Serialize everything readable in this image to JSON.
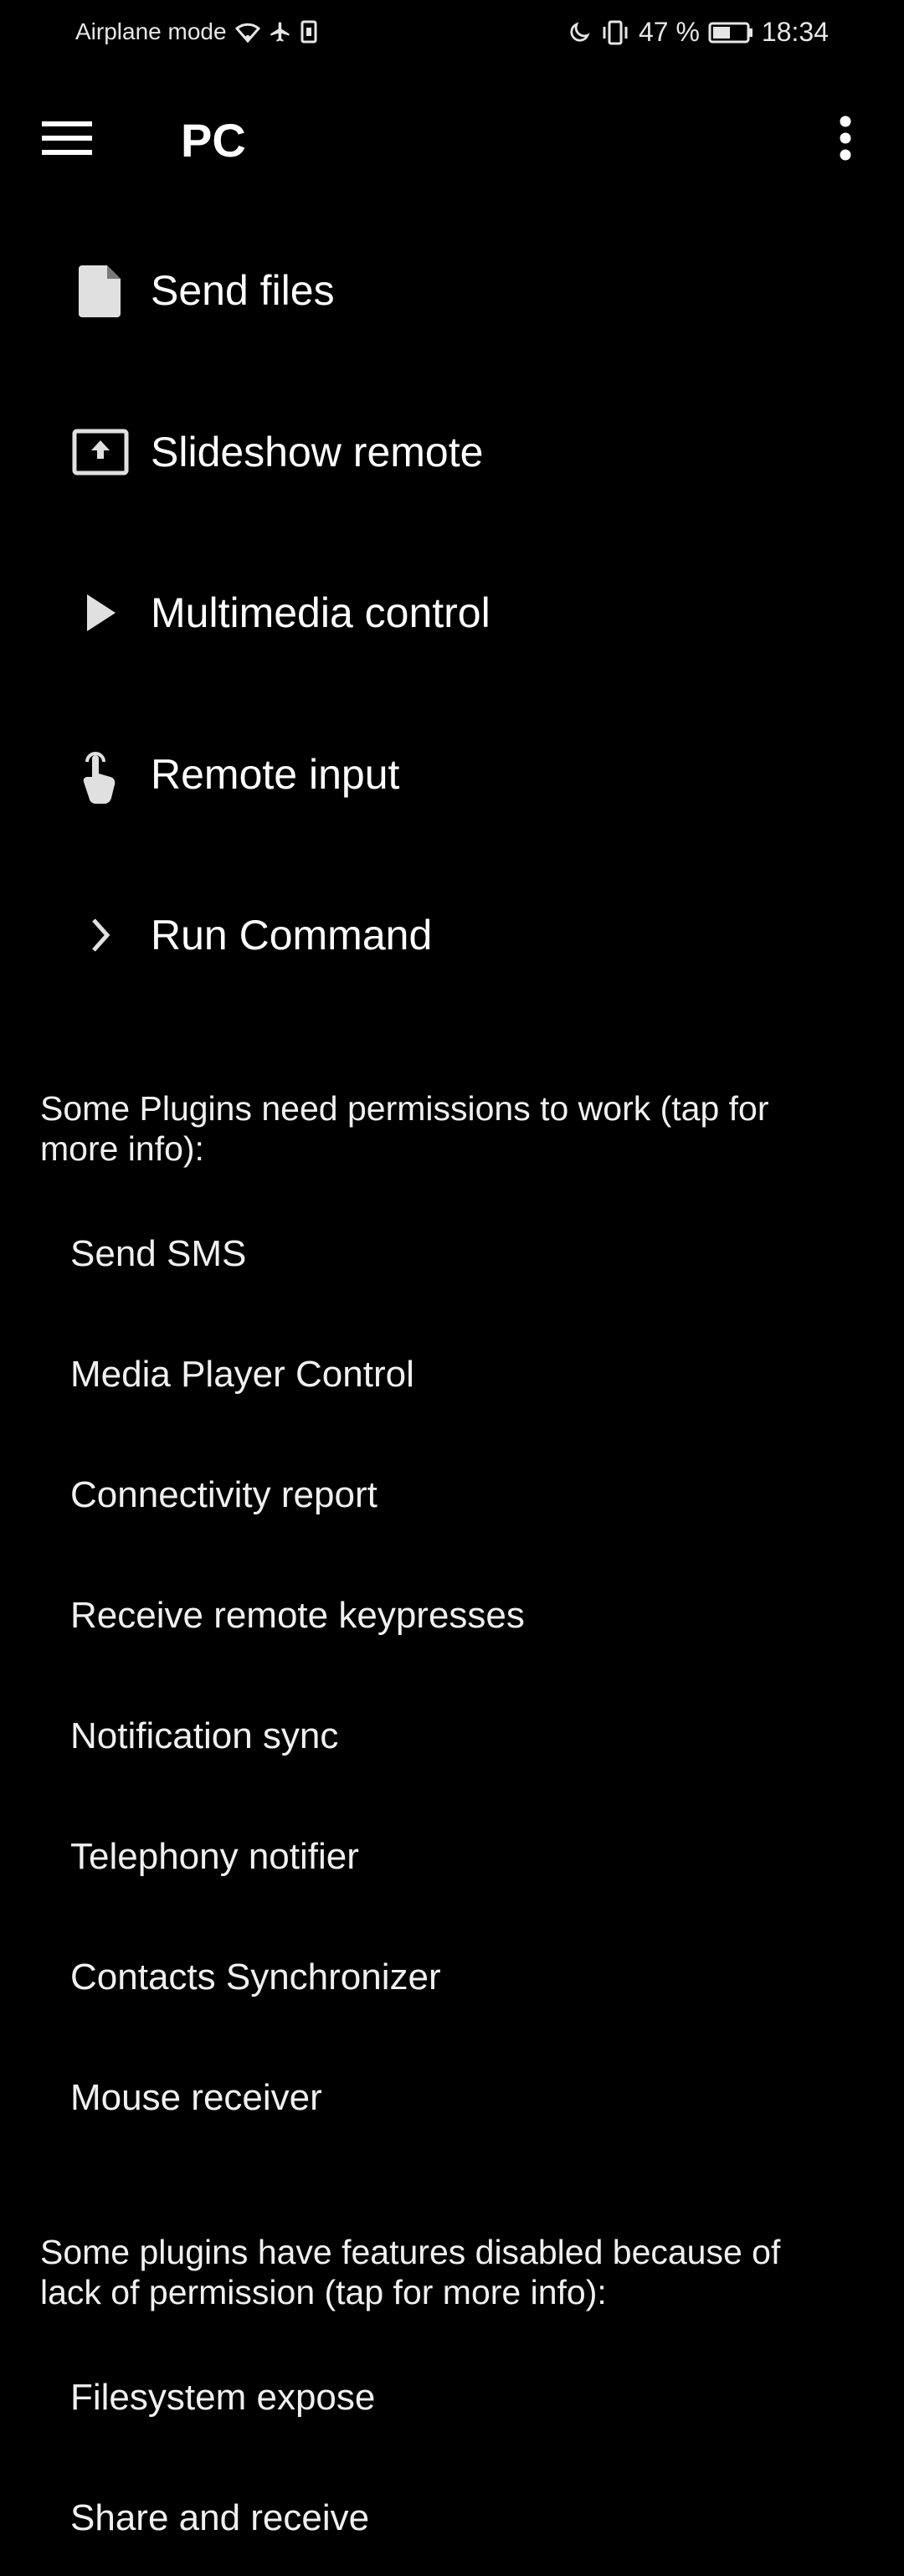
{
  "status_bar": {
    "left_text": "Airplane mode",
    "battery_percent": "47 %",
    "time": "18:34",
    "icons": [
      "wifi-icon",
      "airplane-icon",
      "sim-icon",
      "moon-icon",
      "vibrate-icon",
      "battery-icon"
    ]
  },
  "app_bar": {
    "title": "PC",
    "menu_icon": "hamburger-icon",
    "overflow_icon": "more-vert-icon"
  },
  "actions": [
    {
      "label": "Send files",
      "icon": "file-icon"
    },
    {
      "label": "Slideshow remote",
      "icon": "presentation-icon"
    },
    {
      "label": "Multimedia control",
      "icon": "play-icon"
    },
    {
      "label": "Remote input",
      "icon": "touch-icon"
    },
    {
      "label": "Run Command",
      "icon": "chevron-right-icon"
    }
  ],
  "permissions_section": {
    "header": "Some Plugins need permissions to work (tap for more info):",
    "items": [
      "Send SMS",
      "Media Player Control",
      "Connectivity report",
      "Receive remote keypresses",
      "Notification sync",
      "Telephony notifier",
      "Contacts Synchronizer",
      "Mouse receiver"
    ]
  },
  "disabled_section": {
    "header": "Some plugins have features disabled because of lack of permission (tap for more info):",
    "items": [
      "Filesystem expose",
      "Share and receive"
    ]
  }
}
